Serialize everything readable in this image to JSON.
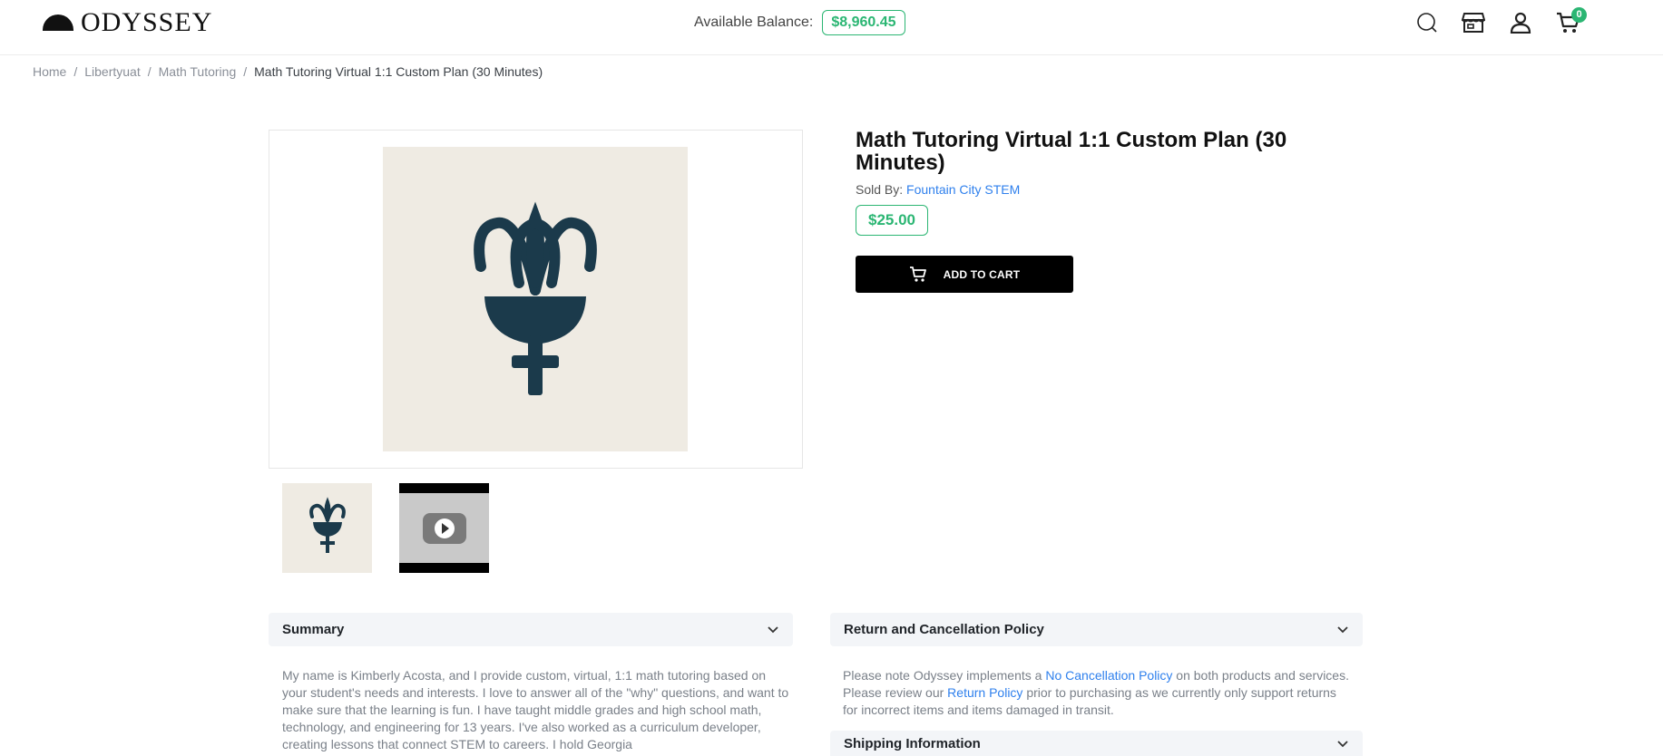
{
  "header": {
    "logo_text": "ODYSSEY",
    "balance_label": "Available Balance:",
    "balance_value": "$8,960.45",
    "icons": [
      "search-icon",
      "store-icon",
      "user-icon",
      "cart-icon"
    ],
    "cart_count": "0"
  },
  "breadcrumb": {
    "items": [
      "Home",
      "Libertyuat",
      "Math Tutoring",
      "Math Tutoring Virtual 1:1 Custom Plan (30 Minutes)"
    ],
    "separator": "/"
  },
  "product": {
    "title": "Math Tutoring Virtual 1:1 Custom Plan (30 Minutes)",
    "sold_by_label": "Sold By:",
    "seller": "Fountain City STEM",
    "price": "$25.00",
    "add_to_cart_label": "ADD TO CART"
  },
  "accordions": {
    "summary": {
      "title": "Summary",
      "text": "My name is Kimberly Acosta, and I provide custom, virtual, 1:1 math tutoring based on your student's needs and interests. I love to answer all of the \"why\" questions, and want to make sure that the learning is fun. I have taught middle grades and high school math, technology, and engineering for 13 years. I've also worked as a curriculum developer, creating lessons that connect STEM to careers. I hold Georgia"
    },
    "return_policy": {
      "title": "Return and Cancellation Policy",
      "text_1": "Please note Odyssey implements a ",
      "link_1": "No Cancellation Policy",
      "text_2": " on both products and services. Please review our ",
      "link_2": "Return Policy",
      "text_3": " prior to purchasing as we currently only support returns for incorrect items and items damaged in transit."
    },
    "shipping": {
      "title": "Shipping Information"
    }
  },
  "colors": {
    "accent_green": "#2bb673",
    "link_blue": "#2f80ed",
    "image_bg": "#efebe3",
    "icon_navy": "#1b3a4b"
  }
}
